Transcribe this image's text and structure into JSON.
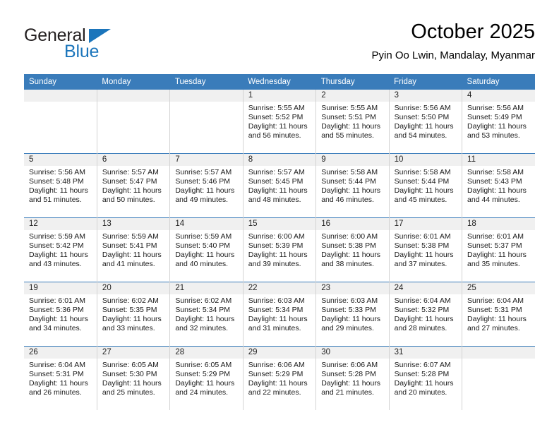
{
  "brand": {
    "name_top": "General",
    "name_bottom": "Blue",
    "accent_color": "#1b75bb",
    "triangle_icon": "triangle-icon"
  },
  "header": {
    "title": "October 2025",
    "subtitle": "Pyin Oo Lwin, Mandalay, Myanmar"
  },
  "calendar": {
    "header_bg": "#3a7cba",
    "daynum_bg": "#f0f0f0",
    "weekdays": [
      "Sunday",
      "Monday",
      "Tuesday",
      "Wednesday",
      "Thursday",
      "Friday",
      "Saturday"
    ],
    "weeks": [
      [
        {
          "day": "",
          "empty": true
        },
        {
          "day": "",
          "empty": true
        },
        {
          "day": "",
          "empty": true
        },
        {
          "day": "1",
          "sunrise": "Sunrise: 5:55 AM",
          "sunset": "Sunset: 5:52 PM",
          "daylight": "Daylight: 11 hours and 56 minutes."
        },
        {
          "day": "2",
          "sunrise": "Sunrise: 5:55 AM",
          "sunset": "Sunset: 5:51 PM",
          "daylight": "Daylight: 11 hours and 55 minutes."
        },
        {
          "day": "3",
          "sunrise": "Sunrise: 5:56 AM",
          "sunset": "Sunset: 5:50 PM",
          "daylight": "Daylight: 11 hours and 54 minutes."
        },
        {
          "day": "4",
          "sunrise": "Sunrise: 5:56 AM",
          "sunset": "Sunset: 5:49 PM",
          "daylight": "Daylight: 11 hours and 53 minutes."
        }
      ],
      [
        {
          "day": "5",
          "sunrise": "Sunrise: 5:56 AM",
          "sunset": "Sunset: 5:48 PM",
          "daylight": "Daylight: 11 hours and 51 minutes."
        },
        {
          "day": "6",
          "sunrise": "Sunrise: 5:57 AM",
          "sunset": "Sunset: 5:47 PM",
          "daylight": "Daylight: 11 hours and 50 minutes."
        },
        {
          "day": "7",
          "sunrise": "Sunrise: 5:57 AM",
          "sunset": "Sunset: 5:46 PM",
          "daylight": "Daylight: 11 hours and 49 minutes."
        },
        {
          "day": "8",
          "sunrise": "Sunrise: 5:57 AM",
          "sunset": "Sunset: 5:45 PM",
          "daylight": "Daylight: 11 hours and 48 minutes."
        },
        {
          "day": "9",
          "sunrise": "Sunrise: 5:58 AM",
          "sunset": "Sunset: 5:44 PM",
          "daylight": "Daylight: 11 hours and 46 minutes."
        },
        {
          "day": "10",
          "sunrise": "Sunrise: 5:58 AM",
          "sunset": "Sunset: 5:44 PM",
          "daylight": "Daylight: 11 hours and 45 minutes."
        },
        {
          "day": "11",
          "sunrise": "Sunrise: 5:58 AM",
          "sunset": "Sunset: 5:43 PM",
          "daylight": "Daylight: 11 hours and 44 minutes."
        }
      ],
      [
        {
          "day": "12",
          "sunrise": "Sunrise: 5:59 AM",
          "sunset": "Sunset: 5:42 PM",
          "daylight": "Daylight: 11 hours and 43 minutes."
        },
        {
          "day": "13",
          "sunrise": "Sunrise: 5:59 AM",
          "sunset": "Sunset: 5:41 PM",
          "daylight": "Daylight: 11 hours and 41 minutes."
        },
        {
          "day": "14",
          "sunrise": "Sunrise: 5:59 AM",
          "sunset": "Sunset: 5:40 PM",
          "daylight": "Daylight: 11 hours and 40 minutes."
        },
        {
          "day": "15",
          "sunrise": "Sunrise: 6:00 AM",
          "sunset": "Sunset: 5:39 PM",
          "daylight": "Daylight: 11 hours and 39 minutes."
        },
        {
          "day": "16",
          "sunrise": "Sunrise: 6:00 AM",
          "sunset": "Sunset: 5:38 PM",
          "daylight": "Daylight: 11 hours and 38 minutes."
        },
        {
          "day": "17",
          "sunrise": "Sunrise: 6:01 AM",
          "sunset": "Sunset: 5:38 PM",
          "daylight": "Daylight: 11 hours and 37 minutes."
        },
        {
          "day": "18",
          "sunrise": "Sunrise: 6:01 AM",
          "sunset": "Sunset: 5:37 PM",
          "daylight": "Daylight: 11 hours and 35 minutes."
        }
      ],
      [
        {
          "day": "19",
          "sunrise": "Sunrise: 6:01 AM",
          "sunset": "Sunset: 5:36 PM",
          "daylight": "Daylight: 11 hours and 34 minutes."
        },
        {
          "day": "20",
          "sunrise": "Sunrise: 6:02 AM",
          "sunset": "Sunset: 5:35 PM",
          "daylight": "Daylight: 11 hours and 33 minutes."
        },
        {
          "day": "21",
          "sunrise": "Sunrise: 6:02 AM",
          "sunset": "Sunset: 5:34 PM",
          "daylight": "Daylight: 11 hours and 32 minutes."
        },
        {
          "day": "22",
          "sunrise": "Sunrise: 6:03 AM",
          "sunset": "Sunset: 5:34 PM",
          "daylight": "Daylight: 11 hours and 31 minutes."
        },
        {
          "day": "23",
          "sunrise": "Sunrise: 6:03 AM",
          "sunset": "Sunset: 5:33 PM",
          "daylight": "Daylight: 11 hours and 29 minutes."
        },
        {
          "day": "24",
          "sunrise": "Sunrise: 6:04 AM",
          "sunset": "Sunset: 5:32 PM",
          "daylight": "Daylight: 11 hours and 28 minutes."
        },
        {
          "day": "25",
          "sunrise": "Sunrise: 6:04 AM",
          "sunset": "Sunset: 5:31 PM",
          "daylight": "Daylight: 11 hours and 27 minutes."
        }
      ],
      [
        {
          "day": "26",
          "sunrise": "Sunrise: 6:04 AM",
          "sunset": "Sunset: 5:31 PM",
          "daylight": "Daylight: 11 hours and 26 minutes."
        },
        {
          "day": "27",
          "sunrise": "Sunrise: 6:05 AM",
          "sunset": "Sunset: 5:30 PM",
          "daylight": "Daylight: 11 hours and 25 minutes."
        },
        {
          "day": "28",
          "sunrise": "Sunrise: 6:05 AM",
          "sunset": "Sunset: 5:29 PM",
          "daylight": "Daylight: 11 hours and 24 minutes."
        },
        {
          "day": "29",
          "sunrise": "Sunrise: 6:06 AM",
          "sunset": "Sunset: 5:29 PM",
          "daylight": "Daylight: 11 hours and 22 minutes."
        },
        {
          "day": "30",
          "sunrise": "Sunrise: 6:06 AM",
          "sunset": "Sunset: 5:28 PM",
          "daylight": "Daylight: 11 hours and 21 minutes."
        },
        {
          "day": "31",
          "sunrise": "Sunrise: 6:07 AM",
          "sunset": "Sunset: 5:28 PM",
          "daylight": "Daylight: 11 hours and 20 minutes."
        },
        {
          "day": "",
          "empty": true
        }
      ]
    ]
  }
}
